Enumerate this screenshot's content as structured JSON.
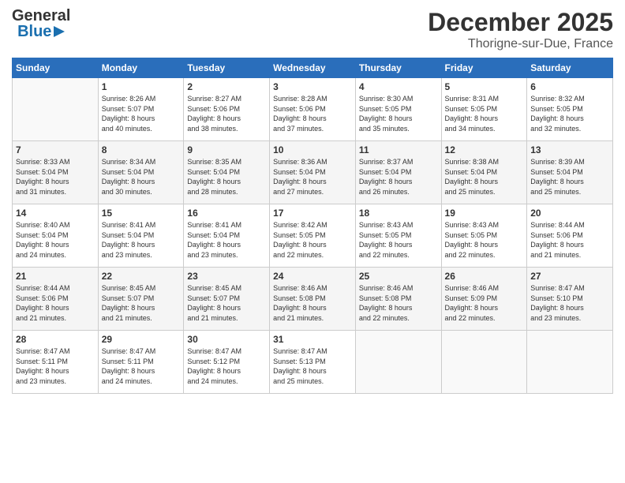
{
  "header": {
    "logo_line1": "General",
    "logo_line2": "Blue",
    "month": "December 2025",
    "location": "Thorigne-sur-Due, France"
  },
  "weekdays": [
    "Sunday",
    "Monday",
    "Tuesday",
    "Wednesday",
    "Thursday",
    "Friday",
    "Saturday"
  ],
  "weeks": [
    [
      {
        "day": "",
        "info": ""
      },
      {
        "day": "1",
        "info": "Sunrise: 8:26 AM\nSunset: 5:07 PM\nDaylight: 8 hours\nand 40 minutes."
      },
      {
        "day": "2",
        "info": "Sunrise: 8:27 AM\nSunset: 5:06 PM\nDaylight: 8 hours\nand 38 minutes."
      },
      {
        "day": "3",
        "info": "Sunrise: 8:28 AM\nSunset: 5:06 PM\nDaylight: 8 hours\nand 37 minutes."
      },
      {
        "day": "4",
        "info": "Sunrise: 8:30 AM\nSunset: 5:05 PM\nDaylight: 8 hours\nand 35 minutes."
      },
      {
        "day": "5",
        "info": "Sunrise: 8:31 AM\nSunset: 5:05 PM\nDaylight: 8 hours\nand 34 minutes."
      },
      {
        "day": "6",
        "info": "Sunrise: 8:32 AM\nSunset: 5:05 PM\nDaylight: 8 hours\nand 32 minutes."
      }
    ],
    [
      {
        "day": "7",
        "info": "Sunrise: 8:33 AM\nSunset: 5:04 PM\nDaylight: 8 hours\nand 31 minutes."
      },
      {
        "day": "8",
        "info": "Sunrise: 8:34 AM\nSunset: 5:04 PM\nDaylight: 8 hours\nand 30 minutes."
      },
      {
        "day": "9",
        "info": "Sunrise: 8:35 AM\nSunset: 5:04 PM\nDaylight: 8 hours\nand 28 minutes."
      },
      {
        "day": "10",
        "info": "Sunrise: 8:36 AM\nSunset: 5:04 PM\nDaylight: 8 hours\nand 27 minutes."
      },
      {
        "day": "11",
        "info": "Sunrise: 8:37 AM\nSunset: 5:04 PM\nDaylight: 8 hours\nand 26 minutes."
      },
      {
        "day": "12",
        "info": "Sunrise: 8:38 AM\nSunset: 5:04 PM\nDaylight: 8 hours\nand 25 minutes."
      },
      {
        "day": "13",
        "info": "Sunrise: 8:39 AM\nSunset: 5:04 PM\nDaylight: 8 hours\nand 25 minutes."
      }
    ],
    [
      {
        "day": "14",
        "info": "Sunrise: 8:40 AM\nSunset: 5:04 PM\nDaylight: 8 hours\nand 24 minutes."
      },
      {
        "day": "15",
        "info": "Sunrise: 8:41 AM\nSunset: 5:04 PM\nDaylight: 8 hours\nand 23 minutes."
      },
      {
        "day": "16",
        "info": "Sunrise: 8:41 AM\nSunset: 5:04 PM\nDaylight: 8 hours\nand 23 minutes."
      },
      {
        "day": "17",
        "info": "Sunrise: 8:42 AM\nSunset: 5:05 PM\nDaylight: 8 hours\nand 22 minutes."
      },
      {
        "day": "18",
        "info": "Sunrise: 8:43 AM\nSunset: 5:05 PM\nDaylight: 8 hours\nand 22 minutes."
      },
      {
        "day": "19",
        "info": "Sunrise: 8:43 AM\nSunset: 5:05 PM\nDaylight: 8 hours\nand 22 minutes."
      },
      {
        "day": "20",
        "info": "Sunrise: 8:44 AM\nSunset: 5:06 PM\nDaylight: 8 hours\nand 21 minutes."
      }
    ],
    [
      {
        "day": "21",
        "info": "Sunrise: 8:44 AM\nSunset: 5:06 PM\nDaylight: 8 hours\nand 21 minutes."
      },
      {
        "day": "22",
        "info": "Sunrise: 8:45 AM\nSunset: 5:07 PM\nDaylight: 8 hours\nand 21 minutes."
      },
      {
        "day": "23",
        "info": "Sunrise: 8:45 AM\nSunset: 5:07 PM\nDaylight: 8 hours\nand 21 minutes."
      },
      {
        "day": "24",
        "info": "Sunrise: 8:46 AM\nSunset: 5:08 PM\nDaylight: 8 hours\nand 21 minutes."
      },
      {
        "day": "25",
        "info": "Sunrise: 8:46 AM\nSunset: 5:08 PM\nDaylight: 8 hours\nand 22 minutes."
      },
      {
        "day": "26",
        "info": "Sunrise: 8:46 AM\nSunset: 5:09 PM\nDaylight: 8 hours\nand 22 minutes."
      },
      {
        "day": "27",
        "info": "Sunrise: 8:47 AM\nSunset: 5:10 PM\nDaylight: 8 hours\nand 23 minutes."
      }
    ],
    [
      {
        "day": "28",
        "info": "Sunrise: 8:47 AM\nSunset: 5:11 PM\nDaylight: 8 hours\nand 23 minutes."
      },
      {
        "day": "29",
        "info": "Sunrise: 8:47 AM\nSunset: 5:11 PM\nDaylight: 8 hours\nand 24 minutes."
      },
      {
        "day": "30",
        "info": "Sunrise: 8:47 AM\nSunset: 5:12 PM\nDaylight: 8 hours\nand 24 minutes."
      },
      {
        "day": "31",
        "info": "Sunrise: 8:47 AM\nSunset: 5:13 PM\nDaylight: 8 hours\nand 25 minutes."
      },
      {
        "day": "",
        "info": ""
      },
      {
        "day": "",
        "info": ""
      },
      {
        "day": "",
        "info": ""
      }
    ]
  ]
}
